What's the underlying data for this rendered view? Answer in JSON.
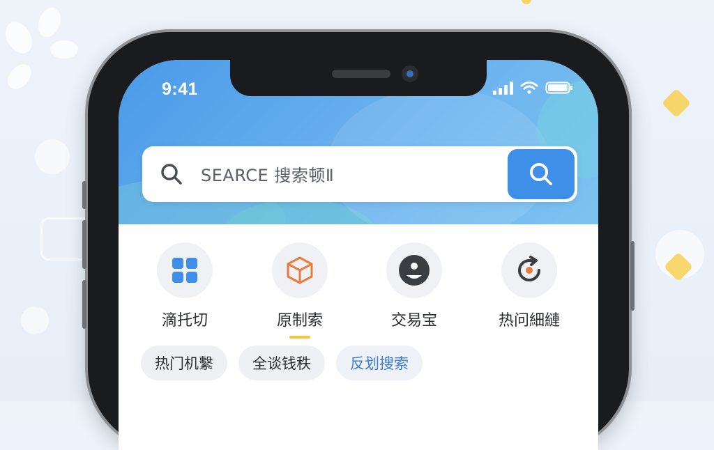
{
  "status_bar": {
    "time": "9:41"
  },
  "search": {
    "text": "SEARCE 搜索顿Ⅱ"
  },
  "quick_actions": [
    {
      "label": "滴托切",
      "icon": "grid-icon"
    },
    {
      "label": "原制索",
      "icon": "box-icon"
    },
    {
      "label": "交易宝",
      "icon": "user-icon"
    },
    {
      "label": "热问細縺",
      "icon": "refresh-icon"
    }
  ],
  "chips": [
    {
      "label": "热门机繫"
    },
    {
      "label": "全谈钱秩"
    },
    {
      "label": "反划搜索"
    }
  ],
  "colors": {
    "header_blue": "#4a9ae8",
    "search_button": "#3d8fe8",
    "accent_yellow": "#f6c53a",
    "active_chip_text": "#3d7ed8"
  }
}
